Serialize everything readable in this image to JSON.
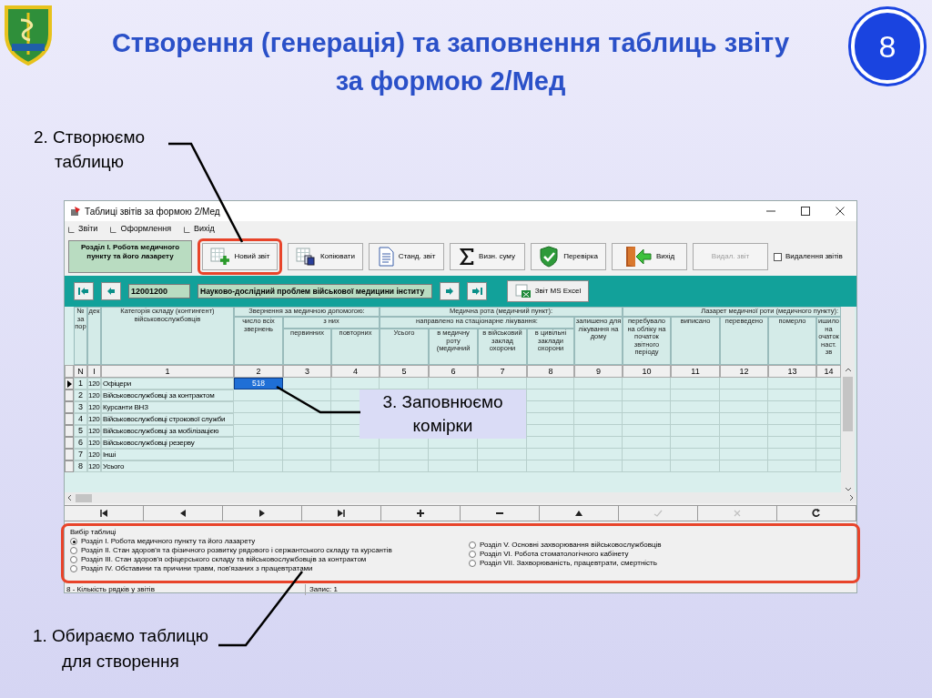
{
  "slide": {
    "title": "Створення (генерація) та заповнення таблиць звіту за формою 2/Мед",
    "page_number": "8"
  },
  "callouts": [
    "2. Створюємо таблицю",
    "3. Заповнюємо комірки",
    "1. Обираємо таблицю для створення"
  ],
  "window": {
    "title": "Таблиці звітів за формою 2/Мед"
  },
  "menu": [
    {
      "label": "Звіти"
    },
    {
      "label": "Оформлення"
    },
    {
      "label": "Вихід"
    }
  ],
  "section_label": "Розділ I. Робота медичного пункту та його лазарету",
  "toolbar": [
    {
      "label": "Новий звіт",
      "kind": "new",
      "disabled": false,
      "highlighted": true
    },
    {
      "label": "Копіювати",
      "kind": "copy",
      "disabled": false,
      "highlighted": false
    },
    {
      "label": "Станд. звіт",
      "kind": "document",
      "disabled": false,
      "highlighted": false
    },
    {
      "label": "Визн. суму",
      "kind": "sum",
      "disabled": false,
      "highlighted": false
    },
    {
      "label": "Перевірка",
      "kind": "check",
      "disabled": false,
      "highlighted": false
    },
    {
      "label": "Вихід",
      "kind": "exit",
      "disabled": false,
      "highlighted": false
    },
    {
      "label": "Видал. звіт",
      "kind": "plain",
      "disabled": true,
      "highlighted": false
    }
  ],
  "delete_reports": {
    "label": "Видалення звітів",
    "checked": false
  },
  "record_bar": {
    "code": "12001200",
    "name": "Науково-дослідний проблем військової медицини інститу",
    "export": "Звіт MS Excel"
  },
  "table": {
    "header": [
      {
        "label": "№ за пор"
      },
      {
        "label": "дек"
      },
      {
        "label": "Категорія складу (контингент) військовослужбовців"
      },
      {
        "label": "Звернення за медичною допомогою:",
        "children": [
          {
            "label": "число всіх звернень"
          },
          {
            "label": "з них",
            "children": [
              {
                "label": "первинних"
              },
              {
                "label": "повторних"
              }
            ]
          }
        ]
      },
      {
        "label": "Медична рота (медичний пункт):",
        "children": [
          {
            "label": "направлено на стаціонарне лікування:",
            "children": [
              {
                "label": "Усього"
              },
              {
                "label": "в медичну роту (медичний"
              },
              {
                "label": "в військовий заклад охорони"
              },
              {
                "label": "в цивільні заклади охорони"
              }
            ]
          },
          {
            "label": "залишено для лікування на дому"
          }
        ]
      },
      {
        "label": "Лазарет  медичної роти  (медичного пункту):",
        "children": [
          {
            "label": "перебувало на обліку на початок звітного періоду"
          },
          {
            "label": "виписано"
          },
          {
            "label": "переведено"
          },
          {
            "label": "померло"
          },
          {
            "label": "ишило на очаток наст. зв"
          }
        ]
      }
    ],
    "column_numbers": [
      "N",
      "I",
      "1",
      "2",
      "3",
      "4",
      "5",
      "6",
      "7",
      "8",
      "9",
      "10",
      "11",
      "12",
      "13",
      "14"
    ],
    "rows": [
      {
        "n": "1",
        "code": "120",
        "category": "Офіцери",
        "selected": true,
        "cells": [
          {
            "value": "518",
            "selected": true
          }
        ]
      },
      {
        "n": "2",
        "code": "120",
        "category": "Військовослужбовці за контрактом",
        "selected": false
      },
      {
        "n": "3",
        "code": "120",
        "category": "Курсанти ВНЗ",
        "selected": false
      },
      {
        "n": "4",
        "code": "120",
        "category": "Військовослужбовці строкової служби",
        "selected": false
      },
      {
        "n": "5",
        "code": "120",
        "category": "Військовослужбовці за мобілізацією",
        "selected": false
      },
      {
        "n": "6",
        "code": "120",
        "category": "Військовослужбовці резерву",
        "selected": false
      },
      {
        "n": "7",
        "code": "120",
        "category": "Інші",
        "selected": false
      },
      {
        "n": "8",
        "code": "120",
        "category": "Усього",
        "selected": false
      }
    ]
  },
  "navigator": [
    {
      "kind": "first",
      "disabled": false
    },
    {
      "kind": "prior",
      "disabled": false
    },
    {
      "kind": "next",
      "disabled": false
    },
    {
      "kind": "last",
      "disabled": false
    },
    {
      "kind": "insert",
      "disabled": false
    },
    {
      "kind": "delete",
      "disabled": false
    },
    {
      "kind": "edit",
      "disabled": false
    },
    {
      "kind": "post",
      "disabled": true
    },
    {
      "kind": "cancel",
      "disabled": true
    },
    {
      "kind": "refresh",
      "disabled": false
    }
  ],
  "table_choice": {
    "legend": "Вибір таблиці",
    "highlighted": true,
    "columns": [
      {
        "options": [
          {
            "label": "Розділ I. Робота медичного пункту та його лазарету",
            "selected": true
          },
          {
            "label": "Розділ II. Стан здоров'я та фізичного розвитку рядового і сержантського складу та курсантів",
            "selected": false
          },
          {
            "label": "Розділ III. Стан здоров'я офіцерського складу та військовослужбовців за контрактом",
            "selected": false
          },
          {
            "label": "Розділ IV. Обставини та причини травм, пов'язаних з працевтратами",
            "selected": false
          }
        ]
      },
      {
        "options": [
          {
            "label": "Розділ V. Основні захворювання військовослужбовців",
            "selected": false
          },
          {
            "label": "Розділ VI. Робота стоматологічного кабінету",
            "selected": false
          },
          {
            "label": "Розділ VII. Захворюваність, працевтрати, смертність",
            "selected": false
          }
        ]
      }
    ]
  },
  "status_bar": {
    "rows_info": "8 - Кількість рядків у звітів",
    "record": "Запис: 1"
  }
}
